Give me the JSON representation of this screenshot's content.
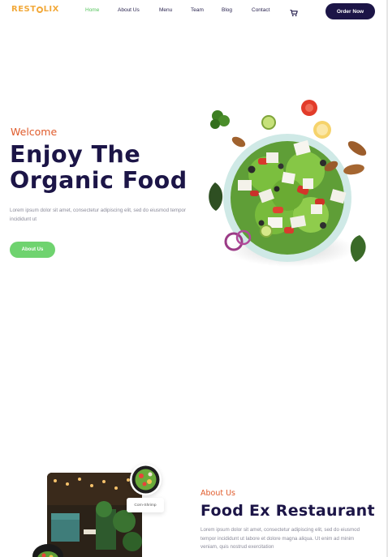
{
  "header": {
    "logo_prefix": "REST",
    "logo_suffix": "LIX",
    "nav": [
      {
        "label": "Home",
        "active": true
      },
      {
        "label": "About Us",
        "active": false
      },
      {
        "label": "Menu",
        "active": false
      },
      {
        "label": "Team",
        "active": false
      },
      {
        "label": "Blog",
        "active": false
      },
      {
        "label": "Contact",
        "active": false
      }
    ],
    "cart_icon": "cart-icon",
    "order_button": "Order Now"
  },
  "hero": {
    "eyebrow": "Welcome",
    "title_line1": "Enjoy The",
    "title_line2": "Organic Food",
    "description": "Lorem ipsum dolor sit amet, consectetur adipiscing elit, sed do eiusmod tempor incididunt ut",
    "cta": "About Us"
  },
  "about": {
    "eyebrow": "About Us",
    "title": "Food Ex Restaurant",
    "description": "Lorem ipsum dolor sit amet, consectetur adipiscing elit, sed do eiusmod tempor incididunt ut labore et dolore magna aliqua. Ut enim ad minim veniam, quis nostrud exercitation",
    "dish_label": "Corn-Shrimp"
  },
  "colors": {
    "brand_dark": "#1c1547",
    "accent_orange": "#e05b2b",
    "accent_green": "#6fd36f",
    "logo_gold": "#f2a93b"
  }
}
